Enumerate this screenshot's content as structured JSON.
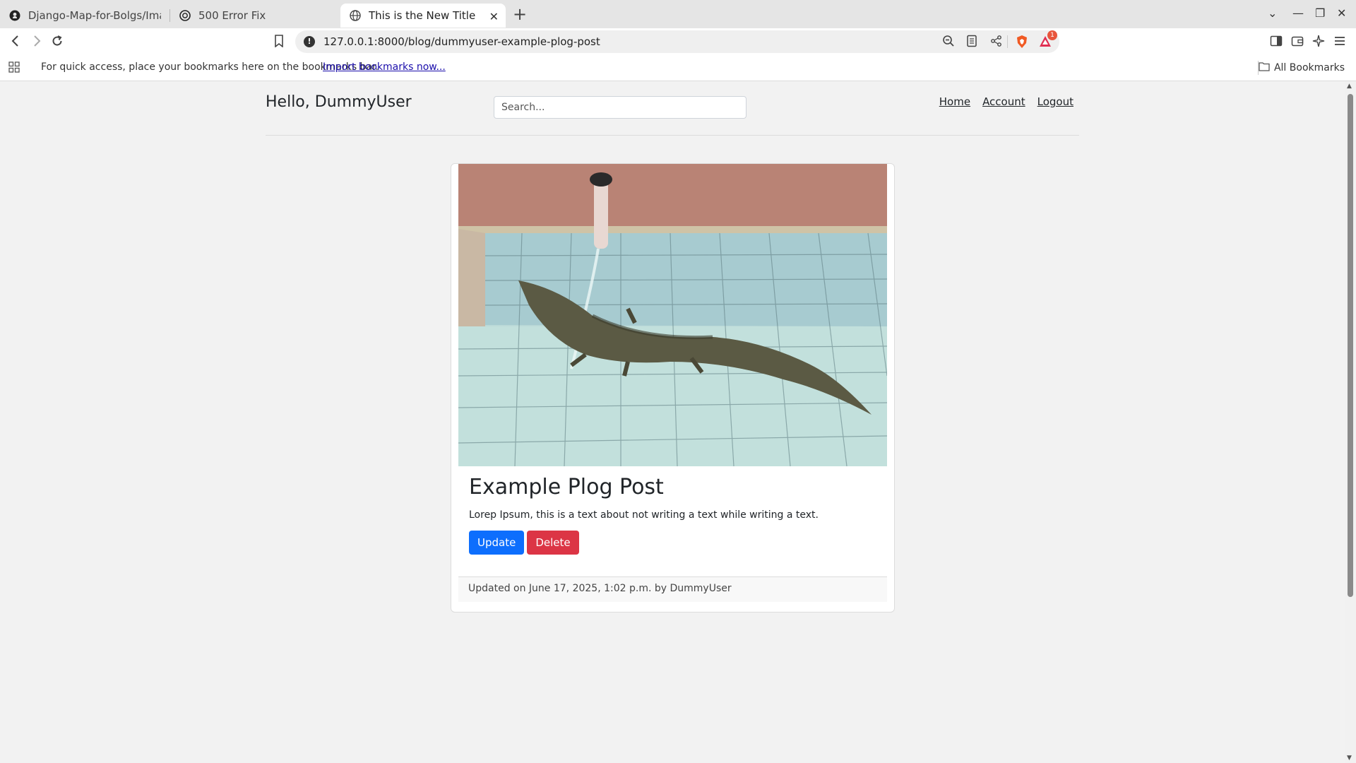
{
  "browser": {
    "tabs": [
      {
        "title": "Django-Map-for-Bolgs/Images a",
        "icon": "github-icon",
        "active": false
      },
      {
        "title": "500 Error Fix",
        "icon": "openai-icon",
        "active": false
      },
      {
        "title": "This is the New Title",
        "icon": "globe-icon",
        "active": true
      }
    ],
    "url": "127.0.0.1:8000/blog/dummyuser-example-plog-post",
    "bookmarks_bar": {
      "message": "For quick access, place your bookmarks here on the bookmarks bar.",
      "import_link": "Import bookmarks now...",
      "all_bookmarks": "All Bookmarks"
    },
    "notification_count": "1"
  },
  "site": {
    "greeting": "Hello, DummyUser",
    "search_placeholder": "Search...",
    "nav": {
      "home": "Home",
      "account": "Account",
      "logout": "Logout"
    }
  },
  "post": {
    "title": "Example Plog Post",
    "body": "Lorep Ipsum, this is a text about not writing a text while writing a text.",
    "update_label": "Update",
    "delete_label": "Delete",
    "footer": "Updated on June 17, 2025, 1:02 p.m. by DummyUser"
  },
  "colors": {
    "primary": "#0d6efd",
    "danger": "#dc3545",
    "brave_orange": "#f05a24"
  }
}
